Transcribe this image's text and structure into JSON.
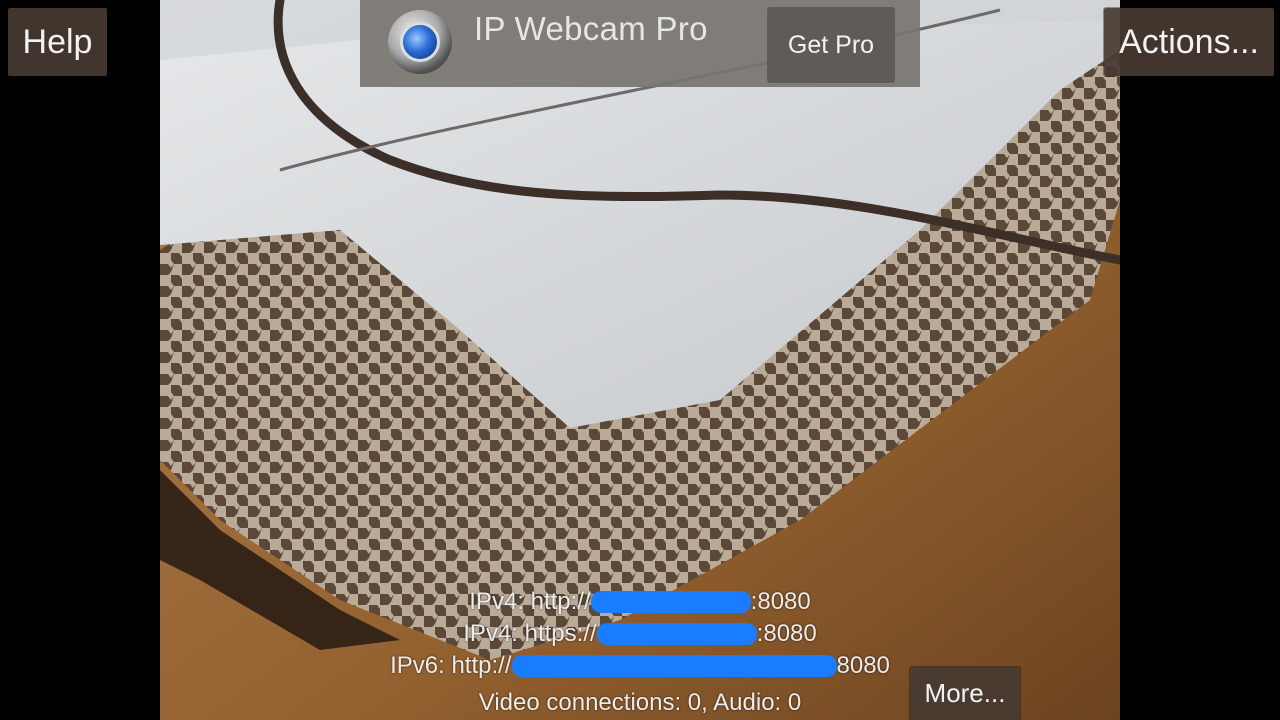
{
  "buttons": {
    "help": "Help",
    "actions": "Actions...",
    "more": "More..."
  },
  "ad": {
    "title": "IP Webcam Pro",
    "cta": "Get Pro",
    "icon": "camera-lens-icon"
  },
  "addresses": [
    {
      "prefix": "IPv4: http://",
      "port": ":8080"
    },
    {
      "prefix": "IPv4: https://",
      "port": ":8080"
    },
    {
      "prefix": "IPv6: http://",
      "port": "8080"
    }
  ],
  "connections": "Video connections: 0, Audio: 0",
  "colors": {
    "redaction": "#1a7cff",
    "button_bg": "#463a32",
    "ad_bg": "#787470"
  }
}
